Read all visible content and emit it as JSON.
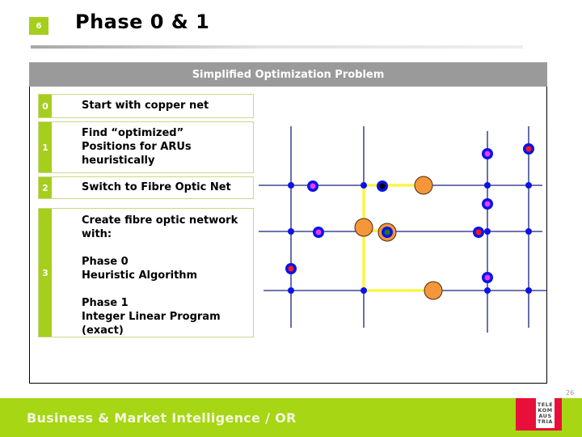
{
  "slide": {
    "number": "6",
    "title": "Phase 0 & 1",
    "page_number": "26"
  },
  "panel": {
    "header": "Simplified Optimization Problem"
  },
  "steps": [
    {
      "badge": "0",
      "lines": [
        "Start with copper net"
      ]
    },
    {
      "badge": "1",
      "lines": [
        "Find “optimized”",
        "Positions for ARUs",
        "heuristically"
      ]
    },
    {
      "badge": "2",
      "lines": [
        "Switch to Fibre Optic Net"
      ]
    },
    {
      "badge": "3",
      "lines": [
        "Create fibre optic network",
        "with:",
        "",
        "Phase 0",
        "Heuristic Algorithm",
        "",
        "Phase 1",
        "Integer Linear Program",
        "(exact)"
      ]
    }
  ],
  "diagram": {
    "colors": {
      "copper_line": "#1a237e",
      "node": "#0a14e6",
      "fibre_line": "#fbf546",
      "aru": "#f6963a",
      "aru_outline": "#4a2a10",
      "customer_magenta": "#e83aff",
      "customer_red": "#ff1a1a",
      "customer_green": "#1f7a1f",
      "customer_black": "#000000"
    },
    "legend_semantics": {
      "small_blue_dot": "network junction",
      "blue_ring_dot": "customer location",
      "orange_circle": "ARU (access remote unit)",
      "yellow_line": "fibre optic link",
      "navy_line": "copper net"
    }
  },
  "footer": {
    "text": "Business & Market Intelligence / OR",
    "logo_lines": [
      "TELE",
      "KOM",
      "AUS",
      "TRIA"
    ]
  }
}
